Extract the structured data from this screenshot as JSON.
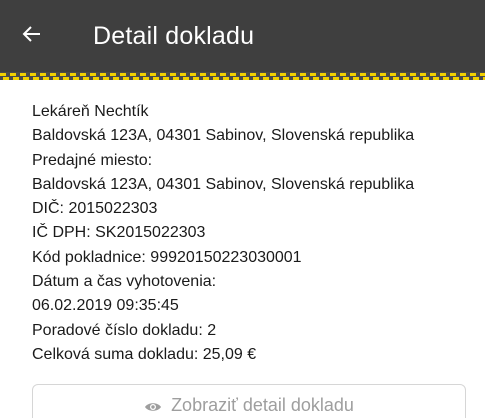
{
  "header": {
    "back_icon": "arrow-left-icon",
    "title": "Detail dokladu"
  },
  "receipt": {
    "lines": [
      "Lekáreň Nechtík",
      "Baldovská 123A, 04301 Sabinov, Slovenská republika",
      "Predajné miesto:",
      "Baldovská 123A, 04301 Sabinov, Slovenská republika",
      "DIČ: 2015022303",
      "IČ DPH: SK2015022303",
      "Kód pokladnice: 99920150223030001",
      "Dátum a čas vyhotovenia:",
      "06.02.2019 09:35:45",
      "Poradové číslo dokladu: 2",
      "Celková suma dokladu: 25,09 €"
    ]
  },
  "actions": {
    "show_detail_icon": "eye-icon",
    "show_detail_label": "Zobraziť detail dokladu"
  },
  "colors": {
    "appbar": "#3f3f3f",
    "accent_dash": "#f2d000",
    "button_text": "#9e9e9e"
  }
}
